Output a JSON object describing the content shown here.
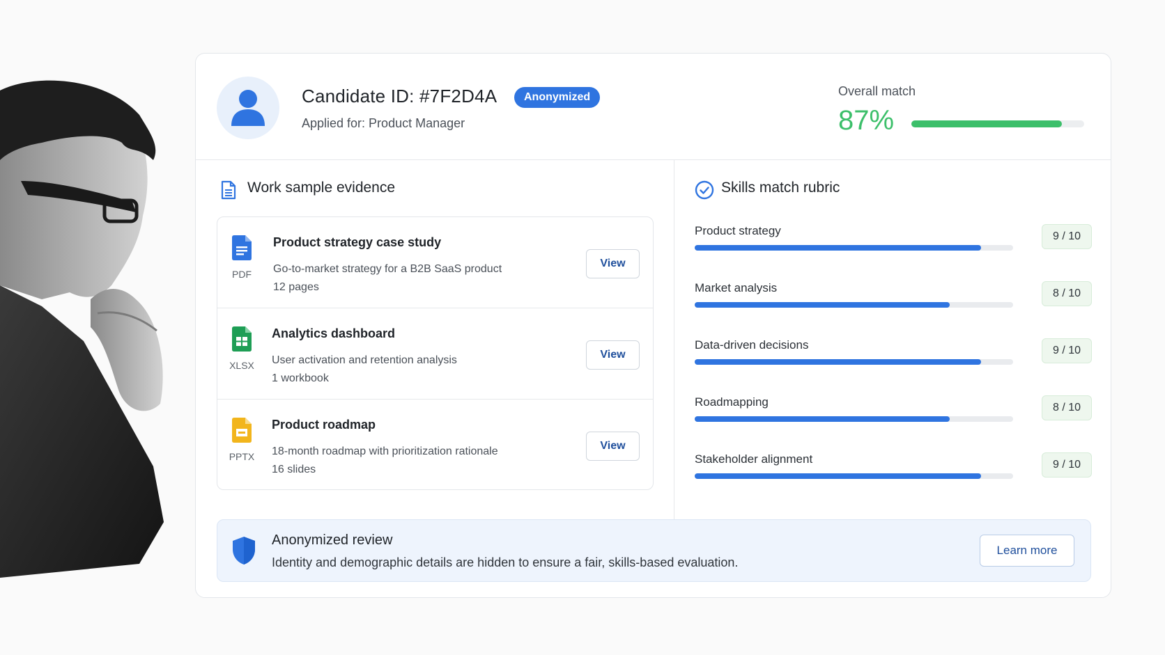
{
  "header": {
    "candidate_title": "Candidate ID: #7F2D4A",
    "badge": "Anonymized",
    "applied_for": "Applied for: Product Manager",
    "overall_label": "Overall match",
    "overall_value": "87%",
    "overall_fraction": 0.87
  },
  "evidence": {
    "title": "Work sample evidence",
    "items": [
      {
        "name": "Product strategy case study",
        "type": "PDF",
        "icon": "doc-icon",
        "color": "#2f74e0",
        "desc": "Go-to-market strategy for a B2B SaaS product",
        "meta": "12 pages",
        "button": "View"
      },
      {
        "name": "Analytics dashboard",
        "type": "XLSX",
        "icon": "sheet-icon",
        "color": "#1e9e55",
        "desc": "User activation and retention analysis",
        "meta": "1 workbook",
        "button": "View"
      },
      {
        "name": "Product roadmap",
        "type": "PPTX",
        "icon": "slides-icon",
        "color": "#f2b51c",
        "desc": "18-month roadmap with prioritization rationale",
        "meta": "16 slides",
        "button": "View"
      }
    ]
  },
  "rubric": {
    "title": "Skills match rubric",
    "rows": [
      {
        "label": "Product strategy",
        "score": "9 / 10",
        "value": 9,
        "max": 10
      },
      {
        "label": "Market analysis",
        "score": "8 / 10",
        "value": 8,
        "max": 10
      },
      {
        "label": "Data-driven decisions",
        "score": "9 / 10",
        "value": 9,
        "max": 10
      },
      {
        "label": "Roadmapping",
        "score": "8 / 10",
        "value": 8,
        "max": 10
      },
      {
        "label": "Stakeholder alignment",
        "score": "9 / 10",
        "value": 9,
        "max": 10
      }
    ]
  },
  "note": {
    "title": "Anonymized review",
    "text": "Identity and demographic details are hidden to ensure a fair, skills-based evaluation.",
    "button": "Learn more"
  },
  "colors": {
    "accent": "#2f74e0",
    "match_green": "#3cbf6a"
  }
}
